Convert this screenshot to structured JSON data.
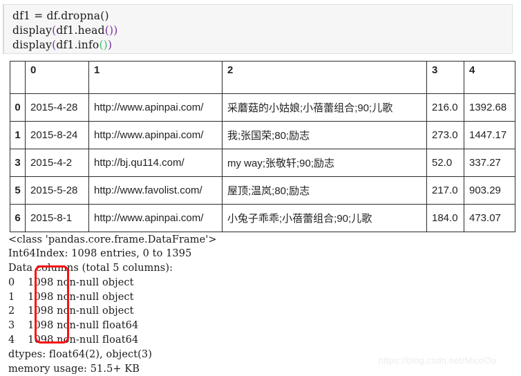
{
  "code_cell": {
    "lines": [
      {
        "before": "df1 = df.dropna",
        "paren": "()",
        "paren_style": "plain",
        "after": ""
      },
      {
        "before": "display",
        "paren": "(",
        "paren_style": "purple",
        "after": "df1.head())"
      },
      {
        "before": "display",
        "paren": "(",
        "paren_style": "purple",
        "after": "df1.info"
      }
    ],
    "line1_full": "df1 = df.dropna()",
    "line2_pre": "display",
    "line2_open": "(",
    "line2_body": "df1.head",
    "line2_inner": "()",
    "line2_close": ")",
    "line3_pre": "display",
    "line3_open": "(",
    "line3_body": "df1.info",
    "line3_inner": "()",
    "line3_close": ")"
  },
  "dataframe": {
    "columns": [
      "0",
      "1",
      "2",
      "3",
      "4"
    ],
    "index_header": "",
    "rows": [
      {
        "index": "0",
        "cells": [
          "2015-4-28",
          "http://www.apinpai.com/",
          "采蘑菇的小姑娘;小蓓蕾组合;90;儿歌",
          "216.0",
          "1392.68"
        ]
      },
      {
        "index": "1",
        "cells": [
          "2015-8-24",
          "http://www.apinpai.com/",
          "我;张国荣;80;励志",
          "273.0",
          "1447.17"
        ]
      },
      {
        "index": "3",
        "cells": [
          "2015-4-2",
          "http://bj.qu114.com/",
          "my way;张敬轩;90;励志",
          "52.0",
          "337.27"
        ]
      },
      {
        "index": "5",
        "cells": [
          "2015-5-28",
          "http://www.favolist.com/",
          "屋顶;温岚;80;励志",
          "217.0",
          "903.29"
        ]
      },
      {
        "index": "6",
        "cells": [
          "2015-8-1",
          "http://www.apinpai.com/",
          "小兔子乖乖;小蓓蕾组合;90;儿歌",
          "184.0",
          "473.07"
        ]
      }
    ]
  },
  "info_output": {
    "text": "<class 'pandas.core.frame.DataFrame'>\nInt64Index: 1098 entries, 0 to 1395\nData columns (total 5 columns):\n0    1098 non-null object\n1    1098 non-null object\n2    1098 non-null object\n3    1098 non-null float64\n4    1098 non-null float64\ndtypes: float64(2), object(3)\nmemory usage: 51.5+ KB"
  },
  "annotation": {
    "color": "#fa0f0f",
    "target_values": [
      "1098",
      "1098",
      "1098",
      "1098",
      "1098"
    ]
  },
  "watermark": {
    "text": "https://blog.csdn.net/MicoOu"
  }
}
